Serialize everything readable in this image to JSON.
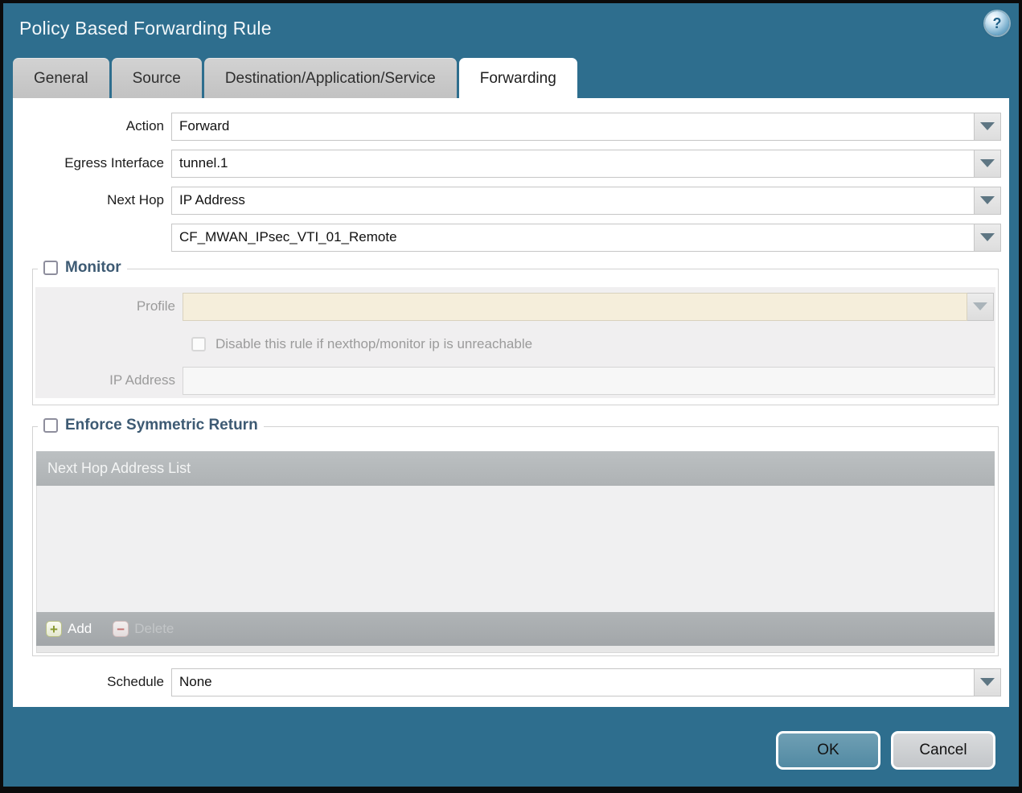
{
  "dialog": {
    "title": "Policy Based Forwarding Rule",
    "help_icon_glyph": "?"
  },
  "tabs": [
    {
      "label": "General",
      "active": false
    },
    {
      "label": "Source",
      "active": false
    },
    {
      "label": "Destination/Application/Service",
      "active": false
    },
    {
      "label": "Forwarding",
      "active": true
    }
  ],
  "form": {
    "action": {
      "label": "Action",
      "value": "Forward"
    },
    "egress_interface": {
      "label": "Egress Interface",
      "value": "tunnel.1"
    },
    "next_hop": {
      "label": "Next Hop",
      "value": "IP Address"
    },
    "next_hop_address": {
      "value": "CF_MWAN_IPsec_VTI_01_Remote"
    },
    "schedule": {
      "label": "Schedule",
      "value": "None"
    }
  },
  "monitor": {
    "legend": "Monitor",
    "checked": false,
    "profile": {
      "label": "Profile",
      "value": ""
    },
    "disable_rule": {
      "label": "Disable this rule if nexthop/monitor ip is unreachable",
      "checked": false
    },
    "ip_address": {
      "label": "IP Address",
      "value": ""
    }
  },
  "enforce": {
    "legend": "Enforce Symmetric Return",
    "checked": false,
    "table": {
      "header": "Next Hop Address List",
      "rows": []
    },
    "add_label": "Add",
    "delete_label": "Delete",
    "delete_enabled": false
  },
  "footer": {
    "ok_label": "OK",
    "cancel_label": "Cancel"
  },
  "colors": {
    "dialog_teal": "#2e6e8e",
    "active_tab": "#ffffff",
    "inactive_tab": "#c6c6c6",
    "cream_field": "#f5eedb",
    "table_header_gray": "#b2b6b8",
    "table_footer_gray": "#a8acaf",
    "ok_button": "#5890a9",
    "cancel_button": "#c9cccf",
    "legend_text": "#3d5a73",
    "add_plus_green": "#88982f",
    "delete_minus_red": "#c4706f"
  }
}
